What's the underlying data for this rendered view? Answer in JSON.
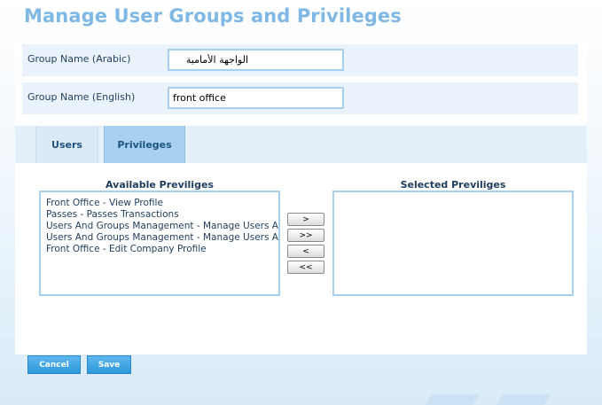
{
  "header": {
    "title": "Manage User Groups and Privileges"
  },
  "form": {
    "arabic_label": "Group Name (Arabic)",
    "arabic_value": "الواجهة الأمامية",
    "english_label": "Group Name (English)",
    "english_value": "front office"
  },
  "tabs": [
    {
      "label": "Users",
      "active": false
    },
    {
      "label": "Privileges",
      "active": true
    }
  ],
  "available": {
    "title": "Available Previliges",
    "items": [
      "Front Office - View Profile",
      "Passes - Passes Transactions",
      "Users And Groups Management - Manage Users And Groups",
      "Users And Groups Management - Manage Users And Groups",
      "Front Office - Edit Company Profile"
    ]
  },
  "selected": {
    "title": "Selected Previliges",
    "items": []
  },
  "move_buttons": {
    "add": ">",
    "add_all": ">>",
    "remove": "<",
    "remove_all": "<<"
  },
  "actions": {
    "cancel": "Cancel",
    "save": "Save"
  },
  "colors": {
    "title": "#7fb8e4",
    "accent": "#2f97dc",
    "tab_active": "#a8d0f0"
  }
}
